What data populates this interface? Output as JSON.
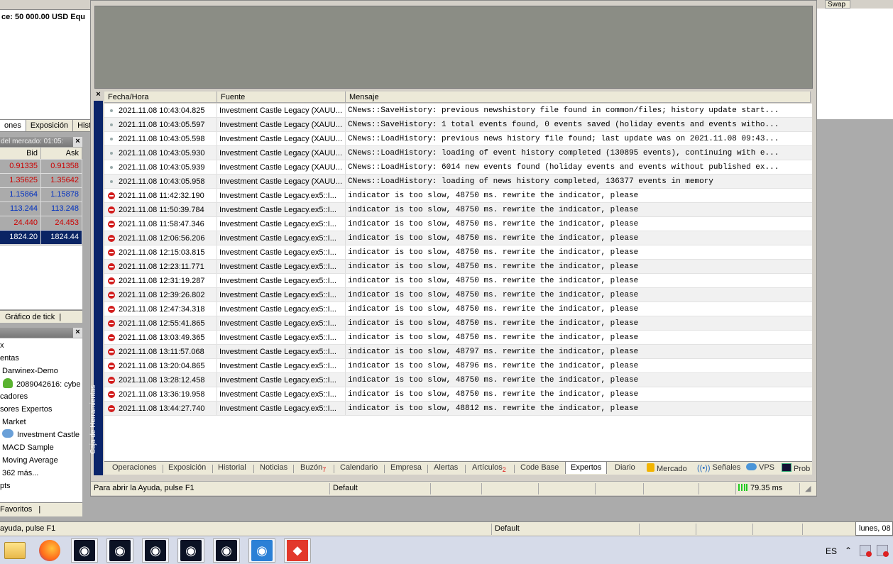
{
  "background": {
    "balance_text": "ce: 50 000.00 USD  Equ",
    "swap_header": "Swap",
    "left_tabs": [
      "ones",
      "Exposición",
      "Hist"
    ],
    "market_watch": {
      "title": "del mercado: 01:05:",
      "col_bid": "Bid",
      "col_ask": "Ask",
      "rows": [
        {
          "bid": "0.91335",
          "ask": "0.91358",
          "dir": "up"
        },
        {
          "bid": "1.35625",
          "ask": "1.35642",
          "dir": "up"
        },
        {
          "bid": "1.15864",
          "ask": "1.15878",
          "dir": "dn"
        },
        {
          "bid": "113.244",
          "ask": "113.248",
          "dir": "dn"
        },
        {
          "bid": "24.440",
          "ask": "24.453",
          "dir": "up"
        },
        {
          "bid": "1824.20",
          "ask": "1824.44",
          "dir": "sel"
        }
      ]
    },
    "tick_tab": "Gráfico de tick",
    "navigator": [
      "x",
      "entas",
      "Darwinex-Demo",
      "2089042616: cybe",
      "cadores",
      "sores Expertos",
      "Market",
      "Investment Castle",
      "MACD Sample",
      "Moving Average",
      "362 más...",
      "pts"
    ],
    "favorites_tab": "Favoritos",
    "status_help": "ayuda, pulse F1",
    "status_profile": "Default",
    "date_text": "lunes, 08"
  },
  "toolbox": {
    "side_title": "Caja de Herramientas",
    "columns": {
      "time": "Fecha/Hora",
      "source": "Fuente",
      "message": "Mensaje"
    },
    "rows": [
      {
        "type": "info",
        "time": "2021.11.08 10:43:04.825",
        "source": "Investment Castle Legacy (XAUU...",
        "message": "CNews::SaveHistory: previous newshistory file found in common/files; history update start..."
      },
      {
        "type": "info",
        "time": "2021.11.08 10:43:05.597",
        "source": "Investment Castle Legacy (XAUU...",
        "message": "CNews::SaveHistory: 1 total events found, 0 events saved (holiday events and events witho..."
      },
      {
        "type": "info",
        "time": "2021.11.08 10:43:05.598",
        "source": "Investment Castle Legacy (XAUU...",
        "message": "CNews::LoadHistory: previous news history file found; last update was on 2021.11.08 09:43..."
      },
      {
        "type": "info",
        "time": "2021.11.08 10:43:05.930",
        "source": "Investment Castle Legacy (XAUU...",
        "message": "CNews::LoadHistory: loading of event history completed (130895 events), continuing with e..."
      },
      {
        "type": "info",
        "time": "2021.11.08 10:43:05.939",
        "source": "Investment Castle Legacy (XAUU...",
        "message": "CNews::LoadHistory: 6014 new events found (holiday events and events without published ex..."
      },
      {
        "type": "info",
        "time": "2021.11.08 10:43:05.958",
        "source": "Investment Castle Legacy (XAUU...",
        "message": "CNews::LoadHistory: loading of news history completed, 136377 events in memory"
      },
      {
        "type": "error",
        "time": "2021.11.08 11:42:32.190",
        "source": "Investment Castle Legacy.ex5::I...",
        "message": "indicator is too slow, 48750 ms. rewrite the indicator, please"
      },
      {
        "type": "error",
        "time": "2021.11.08 11:50:39.784",
        "source": "Investment Castle Legacy.ex5::I...",
        "message": "indicator is too slow, 48750 ms. rewrite the indicator, please"
      },
      {
        "type": "error",
        "time": "2021.11.08 11:58:47.346",
        "source": "Investment Castle Legacy.ex5::I...",
        "message": "indicator is too slow, 48750 ms. rewrite the indicator, please"
      },
      {
        "type": "error",
        "time": "2021.11.08 12:06:56.206",
        "source": "Investment Castle Legacy.ex5::I...",
        "message": "indicator is too slow, 48750 ms. rewrite the indicator, please"
      },
      {
        "type": "error",
        "time": "2021.11.08 12:15:03.815",
        "source": "Investment Castle Legacy.ex5::I...",
        "message": "indicator is too slow, 48750 ms. rewrite the indicator, please"
      },
      {
        "type": "error",
        "time": "2021.11.08 12:23:11.771",
        "source": "Investment Castle Legacy.ex5::I...",
        "message": "indicator is too slow, 48750 ms. rewrite the indicator, please"
      },
      {
        "type": "error",
        "time": "2021.11.08 12:31:19.287",
        "source": "Investment Castle Legacy.ex5::I...",
        "message": "indicator is too slow, 48750 ms. rewrite the indicator, please"
      },
      {
        "type": "error",
        "time": "2021.11.08 12:39:26.802",
        "source": "Investment Castle Legacy.ex5::I...",
        "message": "indicator is too slow, 48750 ms. rewrite the indicator, please"
      },
      {
        "type": "error",
        "time": "2021.11.08 12:47:34.318",
        "source": "Investment Castle Legacy.ex5::I...",
        "message": "indicator is too slow, 48750 ms. rewrite the indicator, please"
      },
      {
        "type": "error",
        "time": "2021.11.08 12:55:41.865",
        "source": "Investment Castle Legacy.ex5::I...",
        "message": "indicator is too slow, 48750 ms. rewrite the indicator, please"
      },
      {
        "type": "error",
        "time": "2021.11.08 13:03:49.365",
        "source": "Investment Castle Legacy.ex5::I...",
        "message": "indicator is too slow, 48750 ms. rewrite the indicator, please"
      },
      {
        "type": "error",
        "time": "2021.11.08 13:11:57.068",
        "source": "Investment Castle Legacy.ex5::I...",
        "message": "indicator is too slow, 48797 ms. rewrite the indicator, please"
      },
      {
        "type": "error",
        "time": "2021.11.08 13:20:04.865",
        "source": "Investment Castle Legacy.ex5::I...",
        "message": "indicator is too slow, 48796 ms. rewrite the indicator, please"
      },
      {
        "type": "error",
        "time": "2021.11.08 13:28:12.458",
        "source": "Investment Castle Legacy.ex5::I...",
        "message": "indicator is too slow, 48750 ms. rewrite the indicator, please"
      },
      {
        "type": "error",
        "time": "2021.11.08 13:36:19.958",
        "source": "Investment Castle Legacy.ex5::I...",
        "message": "indicator is too slow, 48750 ms. rewrite the indicator, please"
      },
      {
        "type": "error",
        "time": "2021.11.08 13:44:27.740",
        "source": "Investment Castle Legacy.ex5::I...",
        "message": "indicator is too slow, 48812 ms. rewrite the indicator, please"
      }
    ],
    "tabs": {
      "operaciones": "Operaciones",
      "exposicion": "Exposición",
      "historial": "Historial",
      "noticias": "Noticias",
      "buzon": "Buzón",
      "buzon_badge": "7",
      "calendario": "Calendario",
      "empresa": "Empresa",
      "alertas": "Alertas",
      "articulos": "Artículos",
      "articulos_badge": "2",
      "codebase": "Code Base",
      "expertos": "Expertos",
      "diario": "Diario",
      "mercado": "Mercado",
      "senales": "Señales",
      "vps": "VPS",
      "prob": "Prob"
    },
    "status": {
      "help": "Para abrir la Ayuda, pulse F1",
      "profile": "Default",
      "ping": "79.35 ms"
    }
  },
  "taskbar": {
    "language": "ES"
  },
  "colors": {
    "error": "#d21c1c",
    "selection": "#0a2464",
    "side_bar": "#0a246a"
  }
}
